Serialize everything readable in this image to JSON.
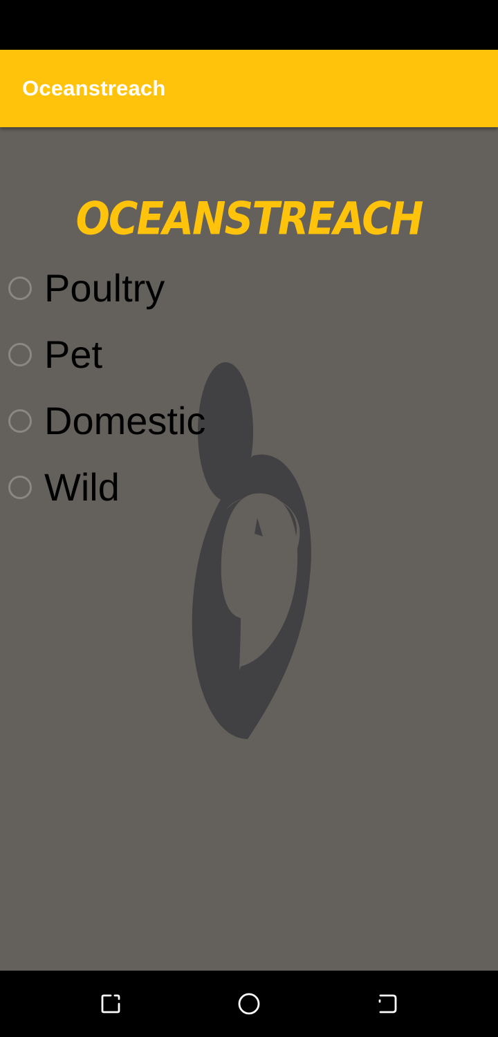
{
  "app": {
    "title": "Oceanstreach",
    "hero_title": "OCEANSTREACH"
  },
  "options": [
    {
      "label": "Poultry",
      "selected": false
    },
    {
      "label": "Pet",
      "selected": false
    },
    {
      "label": "Domestic",
      "selected": false
    },
    {
      "label": "Wild",
      "selected": false
    }
  ],
  "nav": {
    "left_icon": "recent-apps-icon",
    "center_icon": "home-icon",
    "right_icon": "back-icon"
  },
  "colors": {
    "app_bar": "#FFC30B",
    "hero_title": "#FFC30B",
    "content_background": "#64605C",
    "logo": "#414042"
  }
}
